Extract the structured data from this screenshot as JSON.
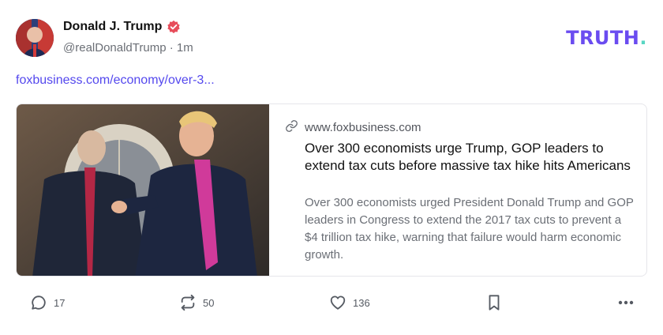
{
  "post": {
    "author_name": "Donald J. Trump",
    "handle": "@realDonaldTrump",
    "separator": "·",
    "time": "1m",
    "link_text": "foxbusiness.com/economy/over-3..."
  },
  "brand": {
    "logo_text": "TRUTH",
    "logo_dot": ".",
    "accent": "#6a4cf0",
    "dot_color": "#58d6c3",
    "link_color": "#5448ee",
    "verified_color": "#e74c5a"
  },
  "card": {
    "domain": "www.foxbusiness.com",
    "title": "Over 300 economists urge Trump, GOP leaders to extend tax cuts before massive tax hike hits Americans",
    "description": "Over 300 economists urged President Donald Trump and GOP leaders in Congress to extend the 2017 tax cuts to prevent a $4 trillion tax hike, warning that failure would harm economic growth."
  },
  "actions": {
    "replies": "17",
    "retruths": "50",
    "likes": "136"
  },
  "icons": {
    "verified": "verified-badge-icon",
    "link": "link-icon",
    "reply": "speech-bubble-icon",
    "retruth": "repost-arrows-icon",
    "like": "heart-icon",
    "bookmark": "bookmark-icon",
    "more": "ellipsis-icon"
  }
}
